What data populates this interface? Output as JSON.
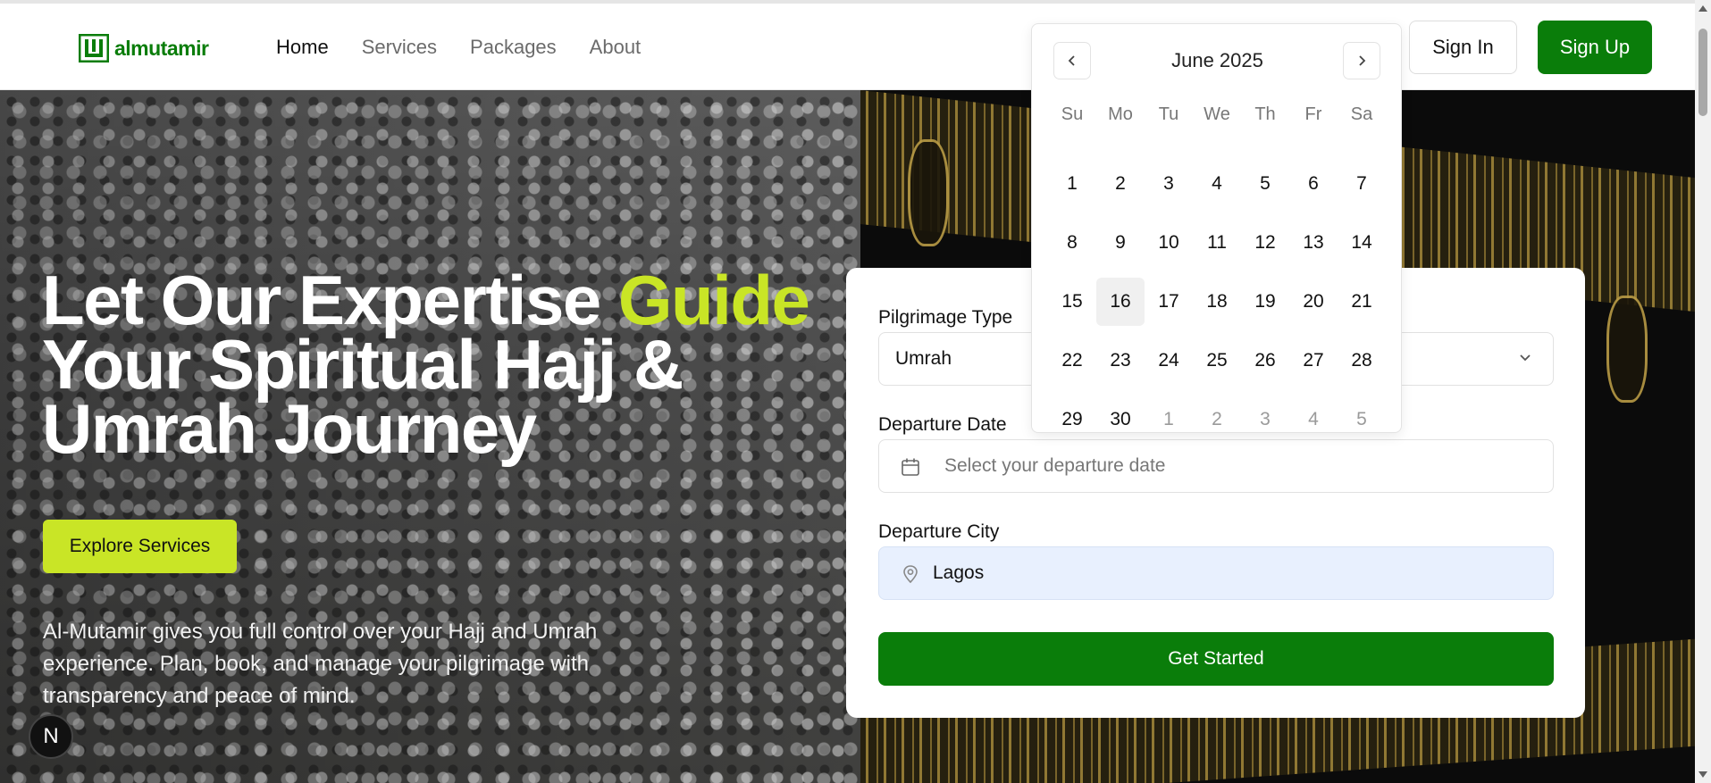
{
  "brand": {
    "name": "almutamir",
    "color": "#0a7d0a"
  },
  "nav": {
    "items": [
      {
        "label": "Home",
        "active": true
      },
      {
        "label": "Services",
        "active": false
      },
      {
        "label": "Packages",
        "active": false
      },
      {
        "label": "About",
        "active": false
      }
    ],
    "sign_in": "Sign In",
    "sign_up": "Sign Up"
  },
  "hero": {
    "headline_part1": "Let Our Expertise ",
    "headline_accent": "Guide",
    "headline_part2": "Your Spiritual Hajj & Umrah Journey",
    "accent_color": "#c9e526",
    "cta": "Explore Services",
    "description": "Al-Mutamir gives you full control over your Hajj and Umrah experience. Plan, book, and manage your pilgrimage with transparency and peace of mind."
  },
  "form": {
    "pilgrimage_type_label": "Pilgrimage Type",
    "pilgrimage_type_value": "Umrah",
    "departure_date_label": "Departure Date",
    "departure_date_placeholder": "Select your departure date",
    "departure_city_label": "Departure City",
    "departure_city_value": "Lagos",
    "submit": "Get Started"
  },
  "calendar": {
    "title": "June 2025",
    "weekdays": [
      "Su",
      "Mo",
      "Tu",
      "We",
      "Th",
      "Fr",
      "Sa"
    ],
    "today": "16",
    "days": [
      "1",
      "2",
      "3",
      "4",
      "5",
      "6",
      "7",
      "8",
      "9",
      "10",
      "11",
      "12",
      "13",
      "14",
      "15",
      "16",
      "17",
      "18",
      "19",
      "20",
      "21",
      "22",
      "23",
      "24",
      "25",
      "26",
      "27",
      "28",
      "29",
      "30",
      "1",
      "2",
      "3",
      "4",
      "5"
    ],
    "outside_from_index": 30
  },
  "badge": {
    "label": "N"
  }
}
